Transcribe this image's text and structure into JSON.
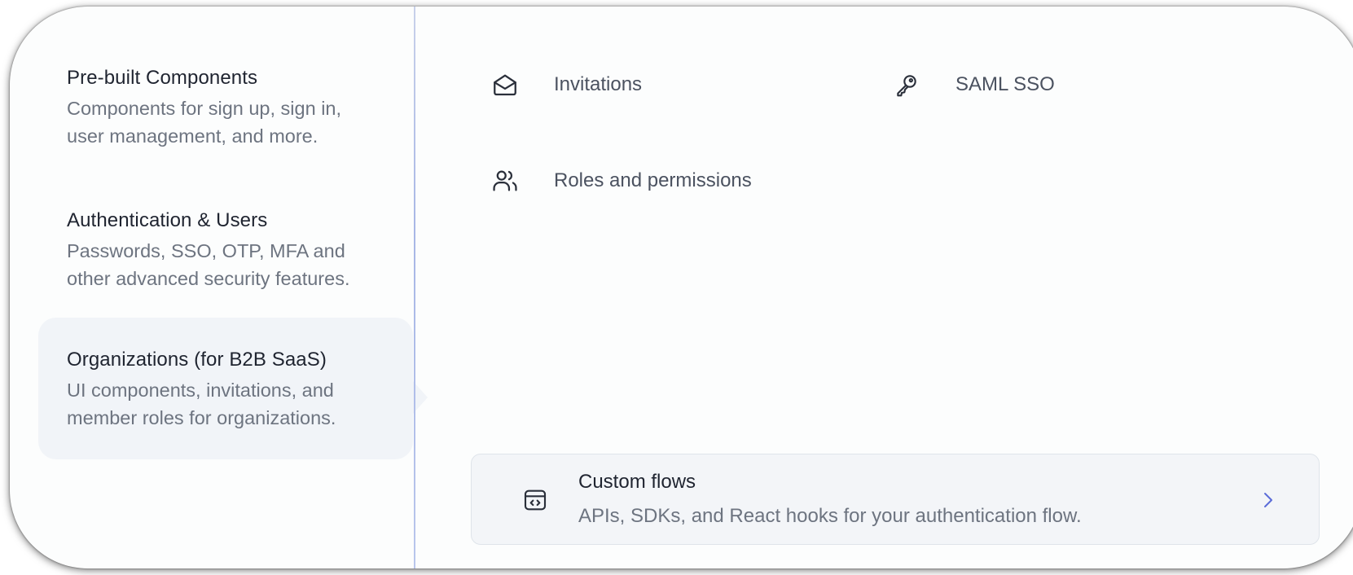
{
  "nav": {
    "items": [
      {
        "title": "Pre-built Components",
        "desc_line1": "Components for sign up, sign in,",
        "desc_line2": "user management, and more.",
        "active": false
      },
      {
        "title": "Authentication & Users",
        "desc_line1": "Passwords, SSO, OTP, MFA and",
        "desc_line2": "other advanced security features.",
        "active": false
      },
      {
        "title": "Organizations (for B2B SaaS)",
        "desc_line1": "UI components, invitations, and",
        "desc_line2": "member roles for organizations.",
        "active": true
      }
    ]
  },
  "features": [
    {
      "label": "Invitations",
      "icon": "envelope-open-icon"
    },
    {
      "label": "SAML SSO",
      "icon": "key-icon"
    },
    {
      "label": "Roles and permissions",
      "icon": "users-icon"
    }
  ],
  "custom_flows": {
    "title": "Custom flows",
    "desc": "APIs, SDKs, and React hooks for your authentication flow.",
    "icon": "code-window-icon",
    "chevron": "chevron-right-icon"
  },
  "colors": {
    "active_bg": "#f1f4f8",
    "divider": "#a8b7e6",
    "chevron": "#5b6cd8"
  }
}
